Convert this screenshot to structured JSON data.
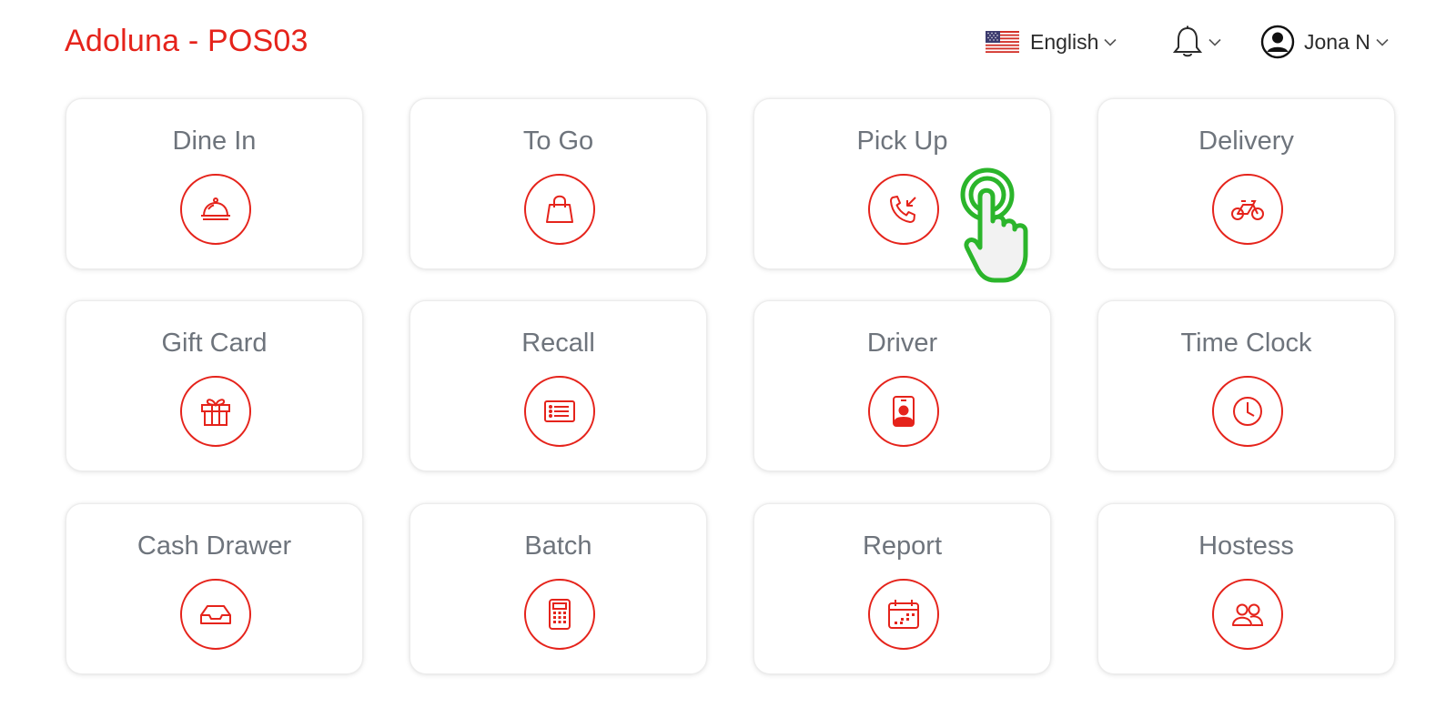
{
  "app": {
    "title": "Adoluna - POS03"
  },
  "header": {
    "language": {
      "label": "English",
      "icon": "us-flag-icon"
    },
    "notifications": {
      "icon": "bell-icon"
    },
    "user": {
      "name": "Jona N",
      "icon": "user-circle-icon"
    }
  },
  "colors": {
    "accent": "#e5231b",
    "label": "#6e747c",
    "pointer": "#2bb52b"
  },
  "tiles": [
    {
      "label": "Dine In",
      "icon": "cloche-icon"
    },
    {
      "label": "To Go",
      "icon": "shopping-bag-icon"
    },
    {
      "label": "Pick Up",
      "icon": "incoming-call-icon"
    },
    {
      "label": "Delivery",
      "icon": "bicycle-icon"
    },
    {
      "label": "Gift Card",
      "icon": "gift-icon"
    },
    {
      "label": "Recall",
      "icon": "receipt-list-icon"
    },
    {
      "label": "Driver",
      "icon": "id-badge-icon"
    },
    {
      "label": "Time Clock",
      "icon": "clock-icon"
    },
    {
      "label": "Cash Drawer",
      "icon": "cash-drawer-icon"
    },
    {
      "label": "Batch",
      "icon": "calculator-icon"
    },
    {
      "label": "Report",
      "icon": "calendar-icon"
    },
    {
      "label": "Hostess",
      "icon": "users-icon"
    }
  ]
}
